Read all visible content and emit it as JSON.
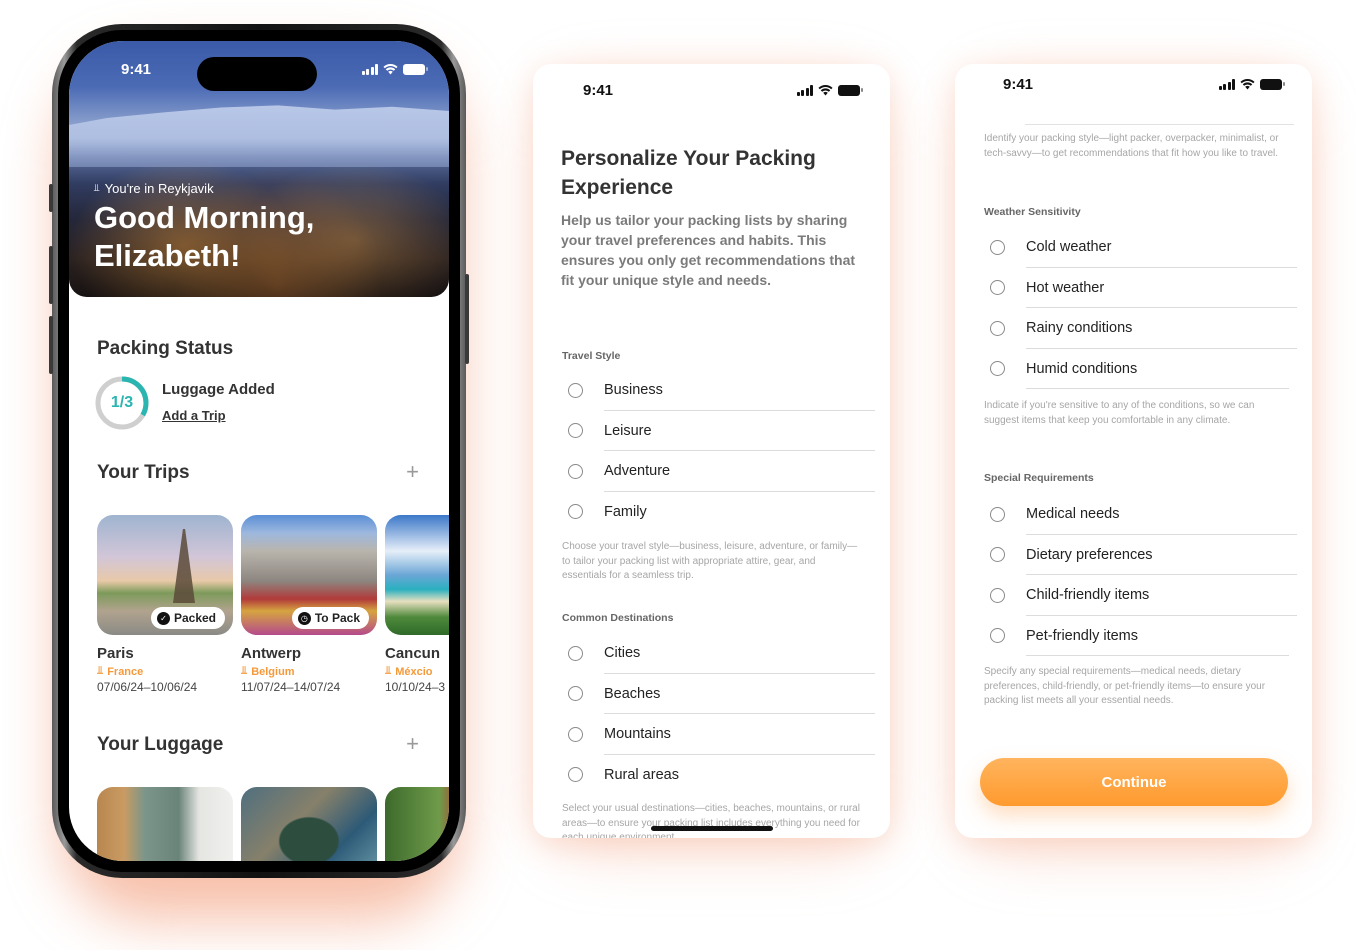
{
  "status_bar": {
    "time": "9:41"
  },
  "home": {
    "location_prefix": "You're in Reykjavik",
    "greeting_line1": "Good Morning,",
    "greeting_line2": "Elizabeth!",
    "packing_status": {
      "title": "Packing Status",
      "progress_label": "1/3",
      "progress_fraction": 0.333,
      "progress_color": "#2ab5b0",
      "status_text": "Luggage Added",
      "link": "Add a Trip"
    },
    "trips": {
      "title": "Your Trips",
      "add_icon": "plus-icon",
      "items": [
        {
          "name": "Paris",
          "country": "France",
          "dates": "07/06/24–10/06/24",
          "badge": "Packed",
          "badge_icon": "check-circle-icon"
        },
        {
          "name": "Antwerp",
          "country": "Belgium",
          "dates": "11/07/24–14/07/24",
          "badge": "To Pack",
          "badge_icon": "clock-icon"
        },
        {
          "name": "Cancun",
          "country": "Méxcio",
          "dates": "10/10/24–3"
        }
      ]
    },
    "luggage": {
      "title": "Your Luggage",
      "add_icon": "plus-icon"
    }
  },
  "personalize": {
    "title": "Personalize Your Packing Experience",
    "description": "Help us tailor your packing lists by sharing your travel preferences and habits. This ensures you only get recommendations that fit your unique style and needs.",
    "travel_style": {
      "label": "Travel Style",
      "options": [
        "Business",
        "Leisure",
        "Adventure",
        "Family"
      ],
      "help": "Choose your travel style—business, leisure, adventure, or family—to tailor your packing list with appropriate attire, gear, and essentials for a seamless trip."
    },
    "destinations": {
      "label": "Common Destinations",
      "options": [
        "Cities",
        "Beaches",
        "Mountains",
        "Rural areas"
      ],
      "help": "Select your usual destinations—cities, beaches, mountains, or rural areas—to ensure your packing list includes everything you need for each unique environment."
    }
  },
  "preferences": {
    "packing_style_help": "Identify your packing style—light packer, overpacker, minimalist, or tech-savvy—to get recommendations that fit how you like to travel.",
    "weather": {
      "label": "Weather Sensitivity",
      "options": [
        "Cold weather",
        "Hot weather",
        "Rainy conditions",
        "Humid conditions"
      ],
      "help": "Indicate if you're sensitive to any of the conditions, so we can suggest items that keep you comfortable in any climate."
    },
    "special": {
      "label": "Special Requirements",
      "options": [
        "Medical needs",
        "Dietary preferences",
        "Child-friendly items",
        "Pet-friendly items"
      ],
      "help": "Specify any special requirements—medical needs, dietary preferences, child-friendly, or pet-friendly items—to ensure your packing list meets all your essential needs."
    },
    "continue_label": "Continue",
    "accent_color": "#ff9a2e"
  }
}
